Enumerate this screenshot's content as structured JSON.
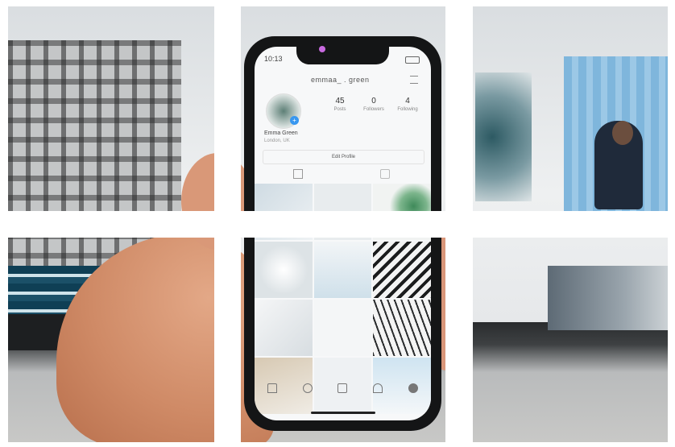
{
  "phone": {
    "status_time": "10:13",
    "username": "emmaa_ . green",
    "stats": [
      {
        "value": "45",
        "label": "Posts"
      },
      {
        "value": "0",
        "label": "Followers"
      },
      {
        "value": "4",
        "label": "Following"
      }
    ],
    "profile_name": "Emma Green",
    "profile_location": "London, UK",
    "edit_profile_label": "Edit Profile"
  },
  "colors": {
    "accent": "#3897f0",
    "phone_frame": "#141516"
  }
}
